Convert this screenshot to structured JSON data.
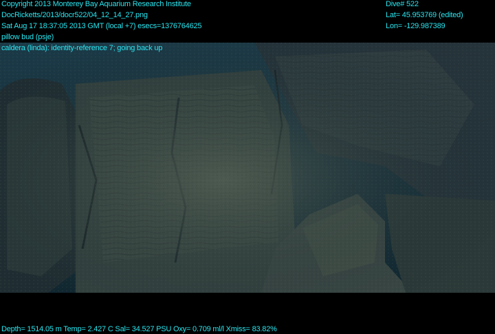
{
  "overlay": {
    "copyright": "Copyright 2013 Monterey Bay Aquarium Research Institute",
    "filename": "DocRicketts/2013/docr522/04_12_14_27.png",
    "datetime": "Sat Aug 17 18:37:05 2013 GMT (local +7)  esecs=1376764625",
    "object": "pillow bud (psje)",
    "note": "caldera (linda): identity-reference 7; going back up",
    "dive": "Dive# 522",
    "lat": "Lat= 45.953769 (edited)",
    "lon": "Lon= -129.987389",
    "sensors": "Depth= 1514.05 m  Temp= 2.427 C  Sal= 34.527 PSU  Oxy= 0.709 ml/l  Xmiss= 83.82%"
  },
  "colors": {
    "overlay_text": "#29e6f0",
    "background": "#000000",
    "rock_dark": "#1c2a2f",
    "rock_mid": "#34433f",
    "rock_light": "#4a5750",
    "water": "#0f2a3a"
  }
}
